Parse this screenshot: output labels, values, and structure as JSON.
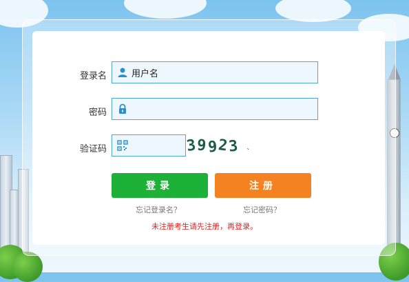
{
  "form": {
    "username_label": "登录名",
    "username_value": "用户名",
    "password_label": "密码",
    "password_value": "",
    "captcha_label": "验证码",
    "captcha_value": "",
    "captcha_text": [
      "3",
      "9",
      "9",
      "2",
      "3"
    ]
  },
  "buttons": {
    "login": "登录",
    "register": "注册"
  },
  "links": {
    "forgot_username": "忘记登录名？",
    "forgot_password": "忘记密码？"
  },
  "notice": "未注册考生请先注册，再登录。",
  "colors": {
    "login_button": "#1db137",
    "register_button": "#f58220",
    "input_border": "#4fa7d8",
    "notice_text": "#e02020"
  },
  "icons": {
    "username": "user-icon",
    "password": "lock-icon",
    "captcha": "qrcode-icon"
  }
}
